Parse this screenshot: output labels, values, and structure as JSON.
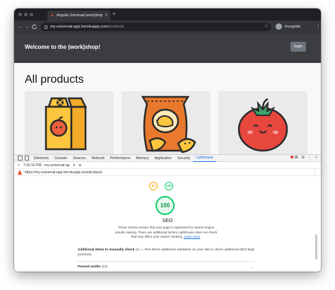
{
  "browser": {
    "tab_title": "Angular Universal (work)shop",
    "tab_close": "×",
    "new_tab": "+",
    "url_host": "my-universal-app.herokuapp.com",
    "url_path": "/products",
    "profile_label": "Incognito",
    "nav_back": "←",
    "nav_forward": "→",
    "nav_reload": "C",
    "star": "☆",
    "menu": "⋮"
  },
  "page": {
    "header_title": "Welcome to the (work)shop!",
    "login_label": "login",
    "section_title": "All products",
    "products": [
      {
        "icon": "juice-carton-icon"
      },
      {
        "icon": "chips-bag-icon"
      },
      {
        "icon": "tomato-icon"
      }
    ]
  },
  "devtools": {
    "tabs": [
      "Elements",
      "Console",
      "Sources",
      "Network",
      "Performance",
      "Memory",
      "Application",
      "Security",
      "Lighthouse"
    ],
    "active_tab": "Lighthouse",
    "error_count": "38",
    "report_selector": "7:32:16 PM - my-universal-ap",
    "report_url": "https://my-universal-app.herokuapp.com/products",
    "gauges_small": [
      {
        "value": "61",
        "color": "#ffa400"
      },
      {
        "value": "100",
        "color": "#0cce6b"
      }
    ],
    "big_score": "100",
    "category_title": "SEO",
    "category_desc": "These checks ensure that your page is optimized for search engine results ranking. There are additional factors Lighthouse does not check that may affect your search ranking.",
    "learn_more": "Learn more",
    "manual_head": "Additional items to manually check",
    "manual_count": "(1)",
    "manual_text": "— Run these additional validators on your site to check additional SEO best practices.",
    "passed_head": "Passed audits",
    "passed_count": "(10)"
  }
}
